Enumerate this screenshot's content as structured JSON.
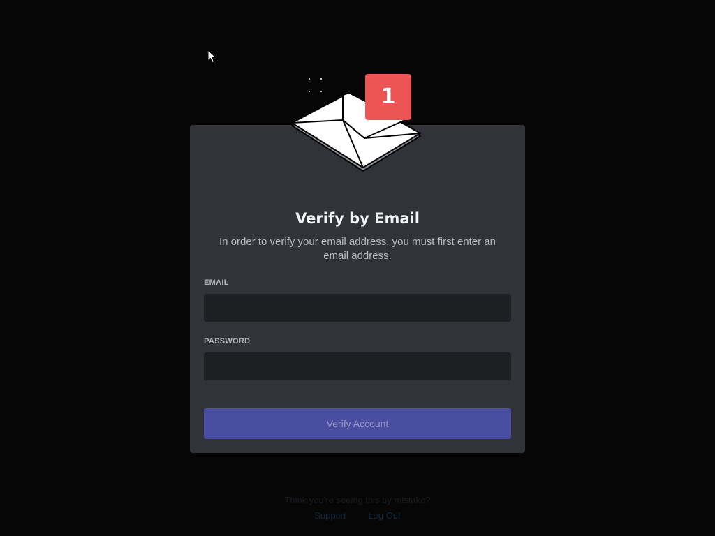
{
  "modal": {
    "title": "Verify by Email",
    "subtitle": "In order to verify your email address, you must first enter an email address.",
    "badge_count": "1",
    "hero_icon": "envelope-icon"
  },
  "form": {
    "email_label": "EMAIL",
    "email_value": "",
    "password_label": "PASSWORD",
    "password_value": "",
    "submit_label": "Verify Account"
  },
  "footer": {
    "text": "Think you're seeing this by mistake?",
    "links": [
      "Support",
      "Log Out"
    ]
  },
  "colors": {
    "background": "#060607",
    "card": "#313338",
    "input": "#1e1f22",
    "button": "#4a4ea0",
    "badge": "#ed5555"
  }
}
